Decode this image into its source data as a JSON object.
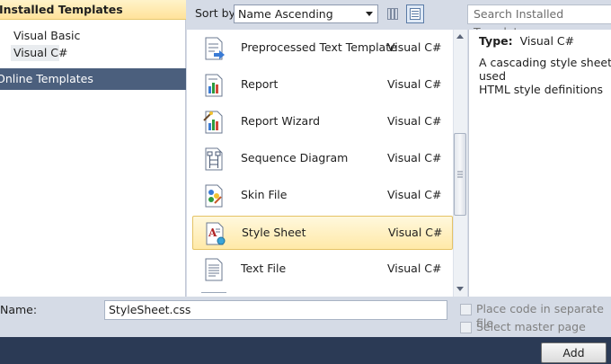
{
  "left_panel": {
    "installed_header": "Installed Templates",
    "tree": [
      {
        "label": "Visual Basic"
      },
      {
        "label": "Visual C#"
      }
    ],
    "online_header": "Online Templates"
  },
  "sort": {
    "label": "Sort by:",
    "value": "Name Ascending"
  },
  "search": {
    "placeholder": "Search Installed Templates"
  },
  "templates": [
    {
      "name": "Preprocessed Text Template",
      "lang": "Visual C#",
      "icon": "text-template-icon"
    },
    {
      "name": "Report",
      "lang": "Visual C#",
      "icon": "report-icon"
    },
    {
      "name": "Report Wizard",
      "lang": "Visual C#",
      "icon": "report-wizard-icon"
    },
    {
      "name": "Sequence Diagram",
      "lang": "Visual C#",
      "icon": "sequence-diagram-icon"
    },
    {
      "name": "Skin File",
      "lang": "Visual C#",
      "icon": "skin-file-icon"
    },
    {
      "name": "Style Sheet",
      "lang": "Visual C#",
      "icon": "style-sheet-icon",
      "selected": true
    },
    {
      "name": "Text File",
      "lang": "Visual C#",
      "icon": "text-file-icon"
    }
  ],
  "details": {
    "type_label": "Type:",
    "type_value": "Visual C#",
    "description": "A cascading style sheet used\nHTML style definitions"
  },
  "name_field": {
    "label": "Name:",
    "value": "StyleSheet.css"
  },
  "options": {
    "place_code": "Place code in separate file",
    "master_page": "Select master page"
  },
  "add_button": "Add",
  "colors": {
    "accent_selected": "#ffe9a8",
    "online_header_bg": "#4b5f7d",
    "footer_bg": "#2b3a55"
  }
}
